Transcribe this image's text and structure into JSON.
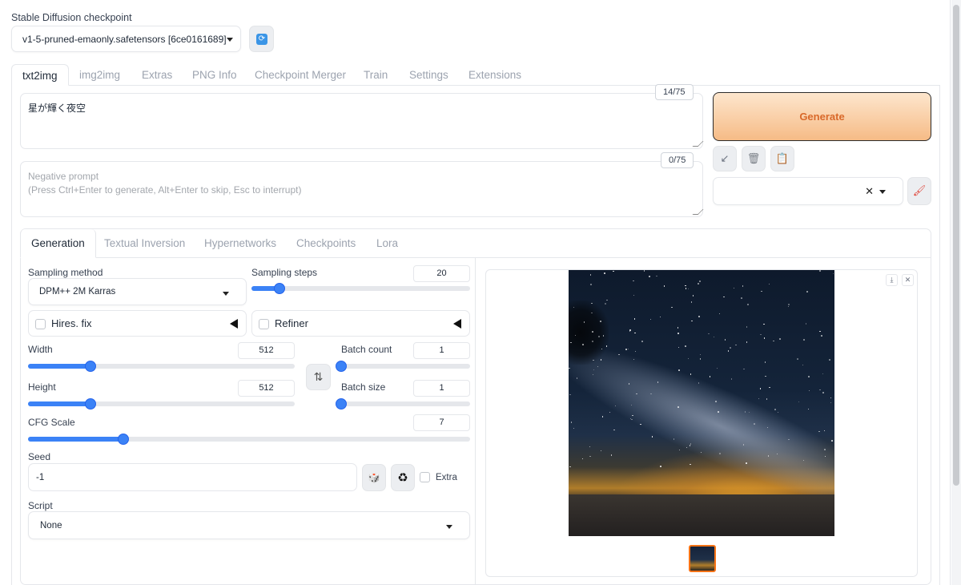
{
  "checkpoint": {
    "label": "Stable Diffusion checkpoint",
    "value": "v1-5-pruned-emaonly.safetensors [6ce0161689]",
    "refresh_icon": "refresh-icon"
  },
  "main_tabs": [
    "txt2img",
    "img2img",
    "Extras",
    "PNG Info",
    "Checkpoint Merger",
    "Train",
    "Settings",
    "Extensions"
  ],
  "prompt": {
    "value": "星が輝く夜空",
    "counter": "14/75"
  },
  "negative_prompt": {
    "placeholder_line1": "Negative prompt",
    "placeholder_line2": "(Press Ctrl+Enter to generate, Alt+Enter to skip, Esc to interrupt)",
    "counter": "0/75"
  },
  "generate": {
    "label": "Generate",
    "colors": {
      "text": "#d9692a",
      "bg_top": "#fde6cd",
      "bg_bottom": "#f6bb86"
    }
  },
  "tool_icons": [
    "paste-arrow-icon",
    "trash-icon",
    "clipboard-icon"
  ],
  "styles": {
    "clear_glyph": "✕",
    "brush_icon": "paintbrush-icon"
  },
  "sub_tabs": [
    "Generation",
    "Textual Inversion",
    "Hypernetworks",
    "Checkpoints",
    "Lora"
  ],
  "generation": {
    "sampling_method": {
      "label": "Sampling method",
      "value": "DPM++ 2M Karras"
    },
    "sampling_steps": {
      "label": "Sampling steps",
      "value": "20",
      "fraction": 0.13
    },
    "hires_fix": {
      "label": "Hires. fix",
      "checked": false
    },
    "refiner": {
      "label": "Refiner",
      "checked": false
    },
    "width": {
      "label": "Width",
      "value": "512",
      "fraction": 0.235
    },
    "height": {
      "label": "Height",
      "value": "512",
      "fraction": 0.235
    },
    "batch_count": {
      "label": "Batch count",
      "value": "1",
      "fraction": 0.0
    },
    "batch_size": {
      "label": "Batch size",
      "value": "1",
      "fraction": 0.0
    },
    "cfg_scale": {
      "label": "CFG Scale",
      "value": "7",
      "fraction": 0.215
    },
    "seed": {
      "label": "Seed",
      "value": "-1"
    },
    "extra": {
      "label": "Extra",
      "checked": false
    },
    "script": {
      "label": "Script",
      "value": "None"
    }
  },
  "gallery": {
    "download_glyph": "⤓",
    "close_glyph": "✕"
  },
  "accent_color": "#3b82f6"
}
